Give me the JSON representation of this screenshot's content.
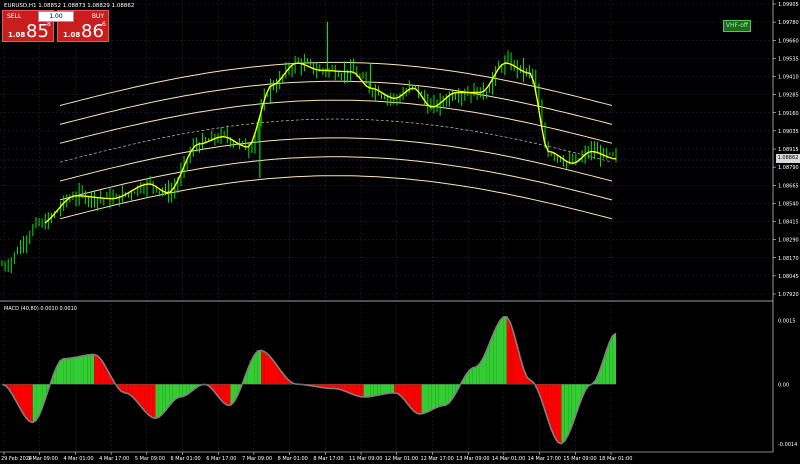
{
  "header": {
    "symbol_line": "EURUSD,H1  1.08852 1.08873 1.08829 1.08862"
  },
  "trade_panel": {
    "sell_label": "SELL",
    "buy_label": "BUY",
    "lot_value": "1.00",
    "sell_price_small": "1.08",
    "sell_price_big": "85",
    "sell_price_sup": "8",
    "buy_price_small": "1.08",
    "buy_price_big": "86",
    "buy_price_sup": "6"
  },
  "vhf_label": "VHF-off",
  "current_price_tag": "1.08862",
  "price_axis": [
    "1.09905",
    "1.09780",
    "1.09660",
    "1.09535",
    "1.09410",
    "1.09285",
    "1.09160",
    "1.09035",
    "1.08915",
    "1.08790",
    "1.08665",
    "1.08540",
    "1.08415",
    "1.08290",
    "1.08170",
    "1.08045",
    "1.07920"
  ],
  "macd": {
    "title": "MACD (40,80) 0.0010 0.0010",
    "axis": [
      "0.0015",
      "0.00",
      "-0.0014"
    ]
  },
  "time_axis": [
    "29 Feb 2024",
    "1 Mar 09:00",
    "4 Mar 01:00",
    "4 Mar 17:00",
    "5 Mar 09:00",
    "6 Mar 01:00",
    "6 Mar 17:00",
    "7 Mar 09:00",
    "8 Mar 01:00",
    "8 Mar 17:00",
    "11 Mar 09:00",
    "12 Mar 01:00",
    "12 Mar 17:00",
    "13 Mar 09:00",
    "14 Mar 01:00",
    "14 Mar 17:00",
    "15 Mar 09:00",
    "18 Mar 01:00"
  ],
  "colors": {
    "background": "#000000",
    "candles": "#00ff00",
    "smooth_line": "#ffff00",
    "bands": "#ffe4b5",
    "center_line": "#bfbfbf",
    "macd_up": "#33cc33",
    "macd_down": "#ff0000",
    "macd_line": "#808080",
    "trade_buttons": "#c81e1e"
  },
  "chart_data": {
    "type": "line",
    "title": "EURUSD,H1",
    "ylim": [
      1.0792,
      1.099
    ],
    "price_path": [
      [
        0,
        1.0813
      ],
      [
        0.06,
        1.084
      ],
      [
        0.12,
        1.086
      ],
      [
        0.18,
        1.0858
      ],
      [
        0.24,
        1.0868
      ],
      [
        0.27,
        1.0862
      ],
      [
        0.32,
        1.0895
      ],
      [
        0.36,
        1.09
      ],
      [
        0.4,
        1.0893
      ],
      [
        0.44,
        1.0935
      ],
      [
        0.48,
        1.095
      ],
      [
        0.52,
        1.0945
      ],
      [
        0.57,
        1.0944
      ],
      [
        0.6,
        1.0933
      ],
      [
        0.64,
        1.0926
      ],
      [
        0.67,
        1.0933
      ],
      [
        0.7,
        1.092
      ],
      [
        0.74,
        1.093
      ],
      [
        0.78,
        1.093
      ],
      [
        0.82,
        1.095
      ],
      [
        0.86,
        1.0943
      ],
      [
        0.89,
        1.089
      ],
      [
        0.93,
        1.0882
      ],
      [
        0.96,
        1.089
      ],
      [
        1.0,
        1.0885
      ]
    ],
    "bands": [
      -2.4,
      -1.6,
      -0.8,
      0.8,
      1.6,
      2.4
    ],
    "macd_path": [
      [
        0,
        0.0
      ],
      [
        0.05,
        -0.0009
      ],
      [
        0.1,
        0.0006
      ],
      [
        0.15,
        0.0007
      ],
      [
        0.2,
        -0.0002
      ],
      [
        0.25,
        -0.0008
      ],
      [
        0.29,
        -0.0003
      ],
      [
        0.33,
        0.0
      ],
      [
        0.37,
        -0.0005
      ],
      [
        0.42,
        0.0008
      ],
      [
        0.48,
        0.0
      ],
      [
        0.54,
        -0.0001
      ],
      [
        0.59,
        -0.0003
      ],
      [
        0.64,
        -0.0002
      ],
      [
        0.68,
        -0.0007
      ],
      [
        0.72,
        -0.0005
      ],
      [
        0.77,
        0.0004
      ],
      [
        0.82,
        0.0016
      ],
      [
        0.86,
        0.0001
      ],
      [
        0.91,
        -0.0014
      ],
      [
        0.96,
        0.0
      ],
      [
        1.0,
        0.0012
      ]
    ],
    "macd_ylim": [
      -0.0015,
      0.0017
    ]
  }
}
